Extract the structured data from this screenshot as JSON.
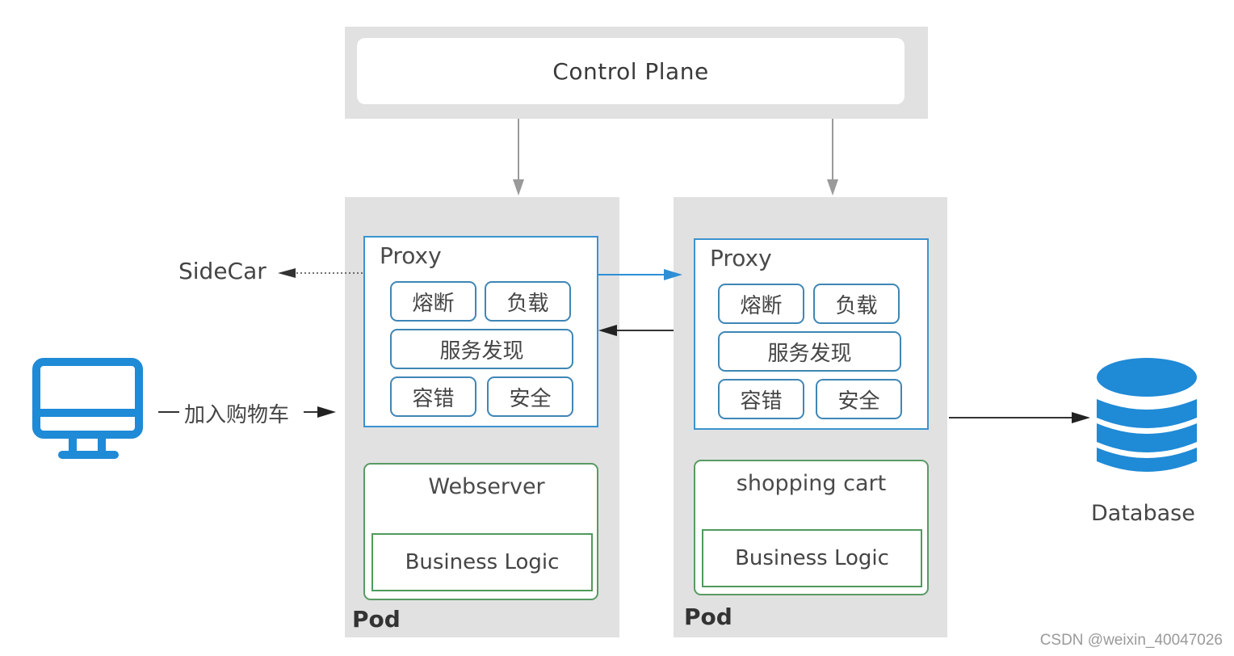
{
  "control_plane": {
    "label": "Control Plane"
  },
  "pods": [
    {
      "pod_label": "Pod",
      "proxy": {
        "title": "Proxy",
        "features": {
          "circuit_breaker": "熔断",
          "load_balancing": "负载",
          "service_discovery": "服务发现",
          "fault_tolerance": "容错",
          "security": "安全"
        }
      },
      "service": {
        "title": "Webserver",
        "logic": "Business Logic"
      }
    },
    {
      "pod_label": "Pod",
      "proxy": {
        "title": "Proxy",
        "features": {
          "circuit_breaker": "熔断",
          "load_balancing": "负载",
          "service_discovery": "服务发现",
          "fault_tolerance": "容错",
          "security": "安全"
        }
      },
      "service": {
        "title": "shopping cart",
        "logic": "Business Logic"
      }
    }
  ],
  "labels": {
    "sidecar": "SideCar",
    "add_to_cart": "加入购物车",
    "database": "Database"
  },
  "icons": {
    "client": "desktop-monitor-icon",
    "database": "database-icon"
  },
  "colors": {
    "accent_blue": "#2d8fd5",
    "proxy_border": "#3a93cf",
    "service_border": "#5a9a64",
    "pod_bg": "#e1e1e1"
  },
  "watermark": "CSDN @weixin_40047026"
}
